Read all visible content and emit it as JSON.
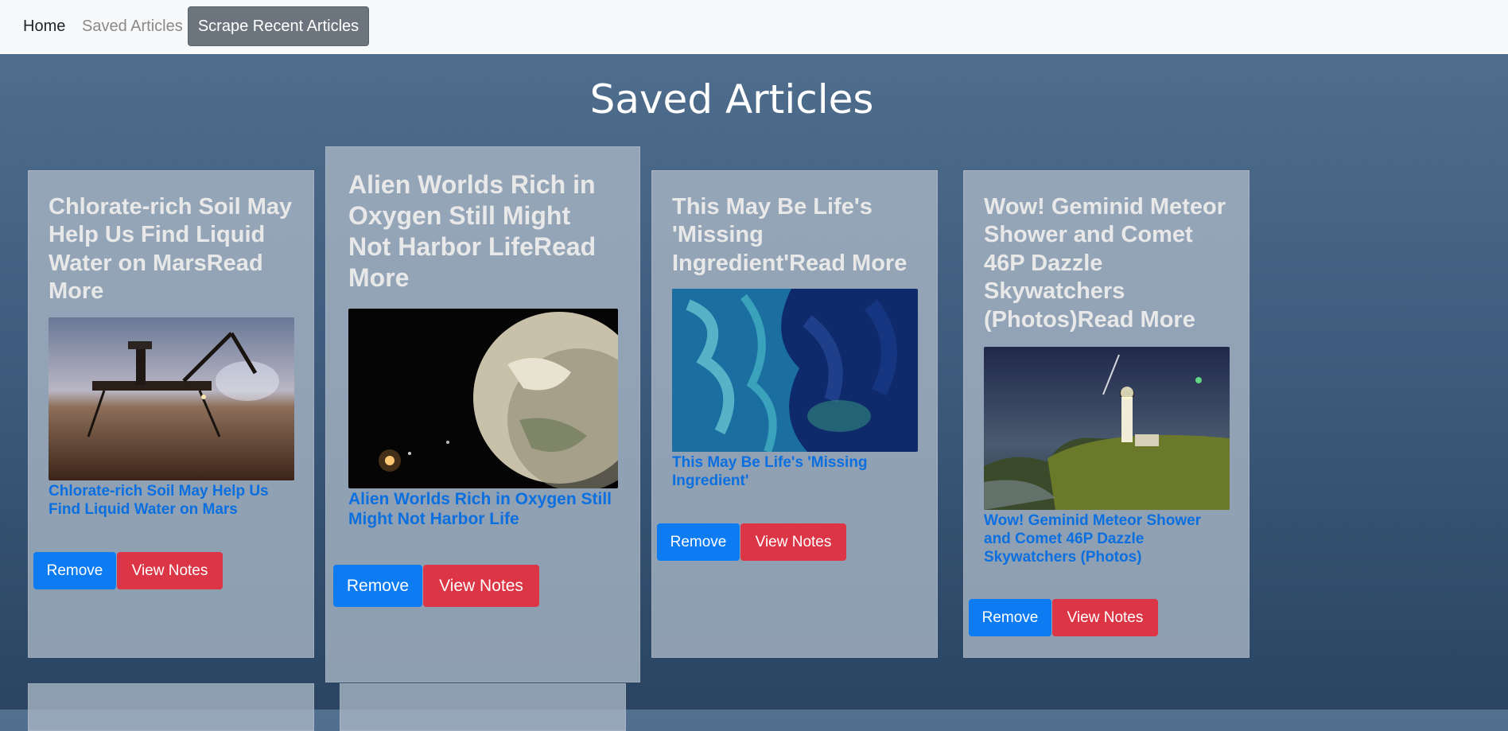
{
  "nav": {
    "home": "Home",
    "saved": "Saved Articles",
    "scrape": "Scrape Recent Articles"
  },
  "page": {
    "title": "Saved Articles"
  },
  "articles": [
    {
      "title": "Chlorate-rich Soil May Help Us Find Liquid Water on MarsRead More",
      "image_alt": "mars-lander-image",
      "link": "Chlorate-rich Soil May Help Us Find Liquid Water on Mars",
      "remove": "Remove",
      "notes": "View Notes"
    },
    {
      "title": "Alien Worlds Rich in Oxygen Still Might Not Harbor LifeRead More",
      "image_alt": "exoplanet-image",
      "link": "Alien Worlds Rich in Oxygen Still Might Not Harbor Life",
      "remove": "Remove",
      "notes": "View Notes"
    },
    {
      "title": "This May Be Life's 'Missing Ingredient'Read More",
      "image_alt": "plankton-bloom-image",
      "link": "This May Be Life's 'Missing Ingredient'",
      "remove": "Remove",
      "notes": "View Notes"
    },
    {
      "title": "Wow! Geminid Meteor Shower and Comet 46P Dazzle Skywatchers (Photos)Read More",
      "image_alt": "lighthouse-meteor-image",
      "link": "Wow! Geminid Meteor Shower and Comet 46P Dazzle Skywatchers (Photos)",
      "remove": "Remove",
      "notes": "View Notes"
    }
  ]
}
